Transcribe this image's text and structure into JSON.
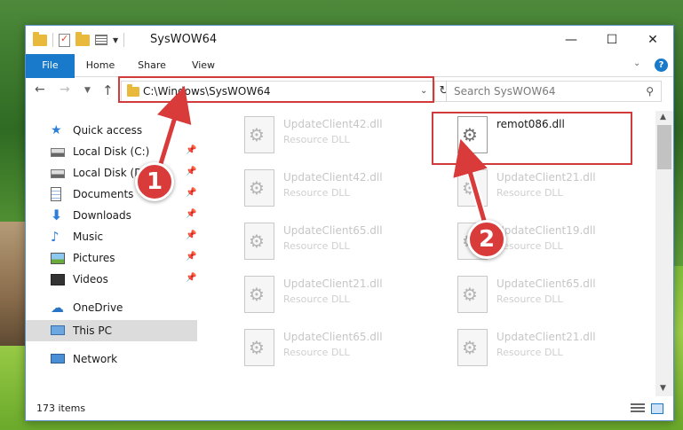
{
  "window": {
    "title": "SysWOW64"
  },
  "ribbon": {
    "tabs": [
      "File",
      "Home",
      "Share",
      "View"
    ]
  },
  "address": {
    "path": "C:\\Windows\\SysWOW64"
  },
  "search": {
    "placeholder": "Search SysWOW64"
  },
  "sidebar": {
    "items": [
      {
        "label": "Quick access",
        "icon": "star-icon",
        "pinned": false
      },
      {
        "label": "Local Disk (C:)",
        "icon": "disk-icon",
        "pinned": true
      },
      {
        "label": "Local Disk (D:)",
        "icon": "disk-icon",
        "pinned": true
      },
      {
        "label": "Documents",
        "icon": "documents-icon",
        "pinned": true
      },
      {
        "label": "Downloads",
        "icon": "download-icon",
        "pinned": true
      },
      {
        "label": "Music",
        "icon": "music-icon",
        "pinned": true
      },
      {
        "label": "Pictures",
        "icon": "pictures-icon",
        "pinned": true
      },
      {
        "label": "Videos",
        "icon": "video-icon",
        "pinned": true
      },
      {
        "label": "OneDrive",
        "icon": "cloud-icon",
        "pinned": false
      },
      {
        "label": "This PC",
        "icon": "computer-icon",
        "pinned": false,
        "selected": true
      },
      {
        "label": "Network",
        "icon": "network-icon",
        "pinned": false
      }
    ]
  },
  "files": [
    {
      "name": "UpdateClient42.dll",
      "type": "Resource DLL"
    },
    {
      "name": "remot086.dll",
      "type": "",
      "highlighted": true
    },
    {
      "name": "UpdateClient42.dll",
      "type": "Resource DLL"
    },
    {
      "name": "UpdateClient21.dll",
      "type": "Resource DLL"
    },
    {
      "name": "UpdateClient65.dll",
      "type": "Resource DLL"
    },
    {
      "name": "UpdateClient19.dll",
      "type": "Resource DLL"
    },
    {
      "name": "UpdateClient21.dll",
      "type": "Resource DLL"
    },
    {
      "name": "UpdateClient65.dll",
      "type": "Resource DLL"
    },
    {
      "name": "UpdateClient65.dll",
      "type": "Resource DLL"
    },
    {
      "name": "UpdateClient21.dll",
      "type": "Resource DLL"
    }
  ],
  "status": {
    "item_count": "173 items"
  },
  "callouts": {
    "step1": "1",
    "step2": "2"
  },
  "colors": {
    "accent": "#1979ca",
    "highlight": "#d23b3b"
  }
}
